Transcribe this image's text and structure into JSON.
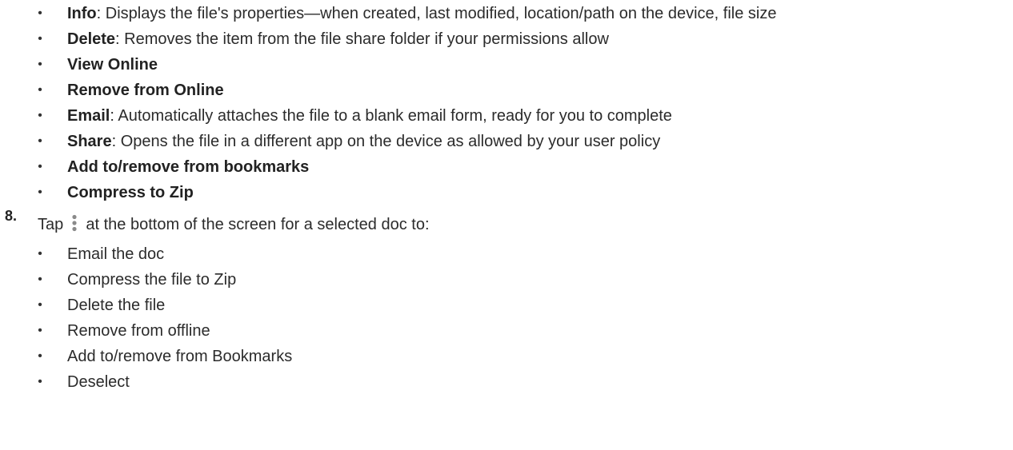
{
  "top_list": [
    {
      "term": "Info",
      "desc": ": Displays the file's properties—when created, last modified, location/path on the device, file size"
    },
    {
      "term": "Delete",
      "desc": ": Removes the item from the file share folder if your permissions allow"
    },
    {
      "term": "View Online",
      "desc": ""
    },
    {
      "term": "Remove from Online",
      "desc": ""
    },
    {
      "term": "Email",
      "desc": ": Automatically attaches the file to a blank email form, ready for you to complete"
    },
    {
      "term": "Share",
      "desc": ": Opens the file in a different app on the device as allowed by your user policy"
    },
    {
      "term": "Add to/remove from bookmarks",
      "desc": ""
    },
    {
      "term": "Compress to Zip",
      "desc": ""
    }
  ],
  "step": {
    "number": "8.",
    "text_before_icon": "Tap",
    "icon": "kebab-menu-icon",
    "text_after_icon": "at the bottom of the screen for a selected doc to:"
  },
  "sub_list": [
    "Email the doc",
    "Compress the file to Zip",
    "Delete the file",
    "Remove from offline",
    "Add to/remove from Bookmarks",
    "Deselect"
  ],
  "bullet_char": "•",
  "colors": {
    "text": "#2b2b2b",
    "icon": "#8a8a8a"
  }
}
